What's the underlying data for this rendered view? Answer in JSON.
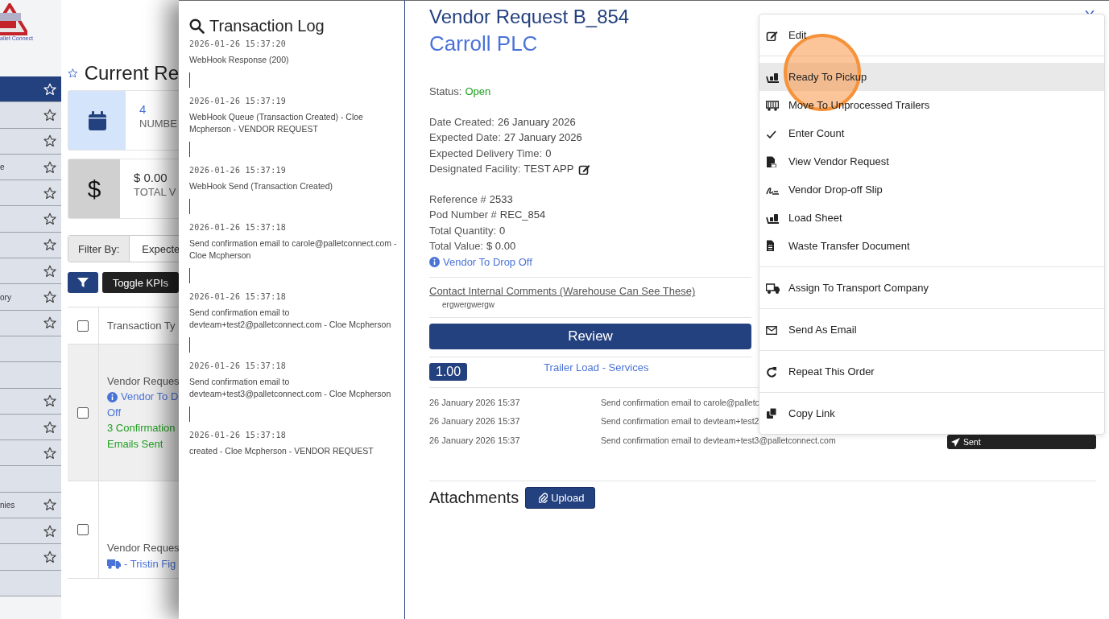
{
  "brand": {
    "caption": "allet Connect"
  },
  "sidebar": {
    "items": [
      {
        "selected": true,
        "favorite": true
      },
      {
        "selected": false,
        "favorite": true
      },
      {
        "selected": false,
        "favorite": true
      },
      {
        "label": "e",
        "selected": false,
        "favorite": true
      },
      {
        "selected": false,
        "favorite": true
      },
      {
        "selected": false,
        "favorite": true
      },
      {
        "selected": false,
        "favorite": true
      },
      {
        "selected": false,
        "favorite": true
      },
      {
        "label": "ory",
        "selected": false,
        "favorite": true
      },
      {
        "selected": false,
        "favorite": true
      },
      {
        "selected": false,
        "favorite": false
      },
      {
        "selected": false,
        "favorite": false
      },
      {
        "selected": false,
        "favorite": true
      },
      {
        "selected": false,
        "favorite": true
      },
      {
        "selected": false,
        "favorite": true
      },
      {
        "selected": false,
        "favorite": false
      },
      {
        "label": "nies",
        "selected": false,
        "favorite": true
      },
      {
        "selected": false,
        "favorite": true
      },
      {
        "selected": false,
        "favorite": true
      },
      {
        "selected": false,
        "favorite": false
      }
    ]
  },
  "page": {
    "title": "Current Re",
    "kpis": [
      {
        "kind": "calendar",
        "value": "4",
        "label": "NUMBE"
      },
      {
        "kind": "dollar",
        "symbol": "$",
        "value": "$ 0.00",
        "label": "TOTAL V"
      }
    ],
    "filter": {
      "label": "Filter By:",
      "value": "Expecte"
    },
    "toggle_button": "Toggle KPIs",
    "table": {
      "header": {
        "checked": false,
        "column_1": "Transaction Ty"
      },
      "rows": [
        {
          "checked": false,
          "selected": true,
          "type": "Vendor Reques",
          "lines": [
            {
              "kind": "info",
              "text": "Vendor To D"
            },
            {
              "kind": "link",
              "text": "Off"
            },
            {
              "kind": "success",
              "text": "3 Confirmation"
            },
            {
              "kind": "success",
              "text": "Emails Sent"
            }
          ]
        },
        {
          "checked": false,
          "selected": false,
          "type": "Vendor Reques",
          "lines": [
            {
              "kind": "truck",
              "text": "- Tristin Fig"
            }
          ]
        }
      ]
    }
  },
  "log": {
    "title": "Transaction Log",
    "entries": [
      {
        "time": "2026-01-26 15:37:20",
        "message": "WebHook Response (200)"
      },
      {
        "time": "2026-01-26 15:37:19",
        "message": "WebHook Queue (Transaction Created) - Cloe Mcpherson - VENDOR REQUEST"
      },
      {
        "time": "2026-01-26 15:37:19",
        "message": "WebHook Send (Transaction Created)"
      },
      {
        "time": "2026-01-26 15:37:18",
        "message": "Send confirmation email to carole@palletconnect.com - Cloe Mcpherson"
      },
      {
        "time": "2026-01-26 15:37:18",
        "message": "Send confirmation email to devteam+test2@palletconnect.com - Cloe Mcpherson"
      },
      {
        "time": "2026-01-26 15:37:18",
        "message": "Send confirmation email to devteam+test3@palletconnect.com - Cloe Mcpherson"
      },
      {
        "time": "2026-01-26 15:37:18",
        "message": "created - Cloe Mcpherson - VENDOR REQUEST"
      }
    ]
  },
  "detail": {
    "title": "Vendor Request B_854",
    "company": "Carroll PLC",
    "status": {
      "label": "Status:",
      "value": "Open"
    },
    "dates": [
      {
        "label": "Date Created:",
        "value": "26 January 2026"
      },
      {
        "label": "Expected Date:",
        "value": "27 January 2026"
      },
      {
        "label": "Expected Delivery Time:",
        "value": "0"
      },
      {
        "label": "Designated Facility:",
        "value": "TEST APP",
        "editable": true
      }
    ],
    "refs": [
      {
        "label": "Reference #",
        "value": "2533"
      },
      {
        "label": "Pod Number #",
        "value": "REC_854"
      },
      {
        "label": "Total Quantity:",
        "value": "0"
      },
      {
        "label": "Total Value:",
        "value": "$ 0.00"
      }
    ],
    "delivery_mode": "Vendor To Drop Off",
    "comments": {
      "heading": "Contact Internal Comments (Warehouse Can See These)",
      "text": "ergwergwergw"
    },
    "review_button": "Review",
    "line_item": {
      "quantity": "1.00",
      "product": "Trailer Load - Services"
    },
    "emails": [
      {
        "date": "26 January 2026 15:37",
        "message": "Send confirmation email to carole@palletc"
      },
      {
        "date": "26 January 2026 15:37",
        "message": "Send confirmation email to devteam+test2"
      },
      {
        "date": "26 January 2026 15:37",
        "message": "Send confirmation email to devteam+test3@palletconnect.com",
        "badge": "Sent"
      }
    ],
    "attachments": {
      "heading": "Attachments",
      "button": "Upload"
    }
  },
  "menu": {
    "groups": [
      {
        "items": [
          {
            "kind": "edit",
            "label": "Edit",
            "selected": false
          }
        ]
      },
      {
        "items": [
          {
            "kind": "dolly",
            "label": "Ready To Pickup",
            "selected": true
          },
          {
            "kind": "trailer",
            "label": "Move To Unprocessed Trailers",
            "selected": false
          },
          {
            "kind": "check",
            "label": "Enter Count",
            "selected": false
          },
          {
            "kind": "pdf",
            "label": "View Vendor Request",
            "selected": false
          },
          {
            "kind": "signature",
            "label": "Vendor Drop-off Slip",
            "selected": false
          },
          {
            "kind": "dolly",
            "label": "Load Sheet",
            "selected": false
          },
          {
            "kind": "file",
            "label": "Waste Transfer Document",
            "selected": false
          }
        ]
      },
      {
        "items": [
          {
            "kind": "truck",
            "label": "Assign To Transport Company",
            "selected": false
          }
        ]
      },
      {
        "items": [
          {
            "kind": "envelope",
            "label": "Send As Email",
            "selected": false
          }
        ]
      },
      {
        "items": [
          {
            "kind": "redo",
            "label": "Repeat This Order",
            "selected": false
          }
        ]
      },
      {
        "items": [
          {
            "kind": "copy",
            "label": "Copy Link",
            "selected": false
          }
        ]
      }
    ]
  }
}
